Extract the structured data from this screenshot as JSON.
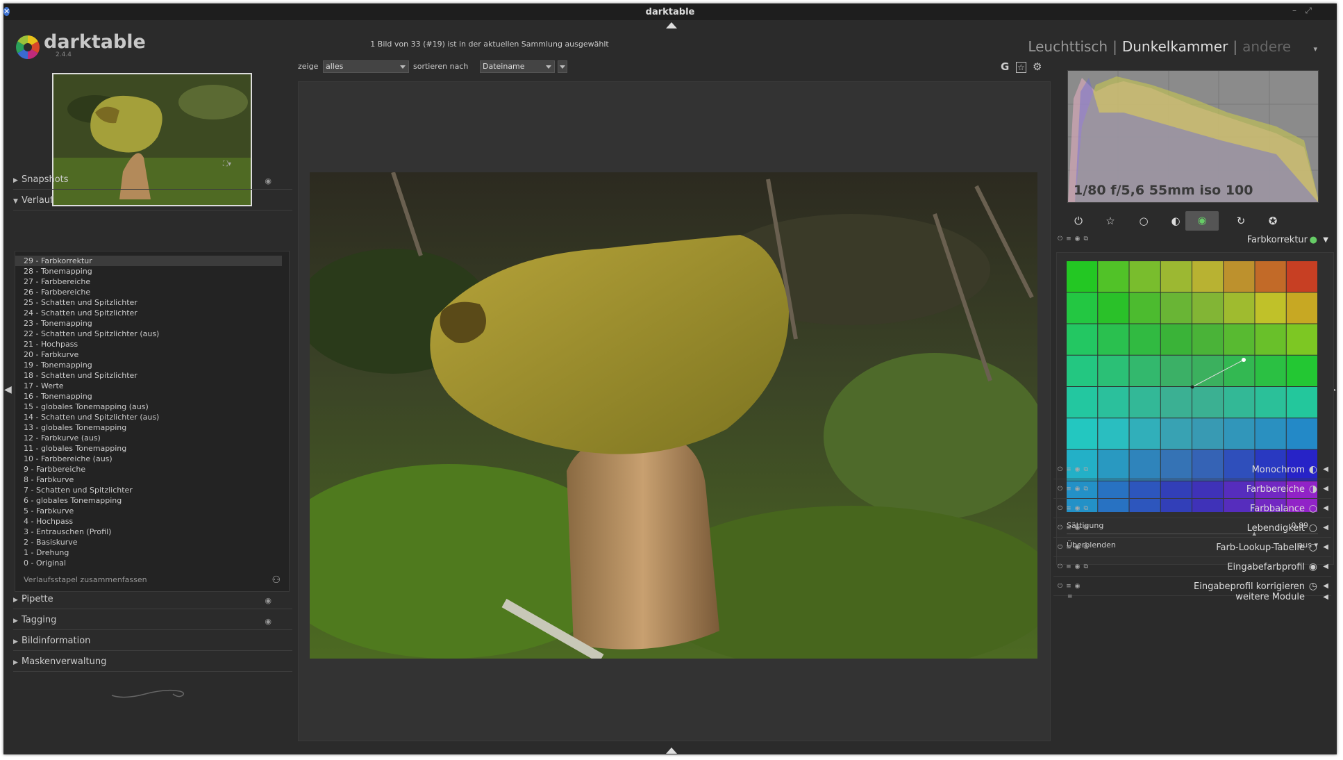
{
  "window": {
    "title": "darktable"
  },
  "app": {
    "name": "darktable",
    "version": "2.4.4"
  },
  "selection_info": "1 Bild von 33 (#19) ist in der aktuellen Sammlung ausgewählt",
  "views": {
    "lighttable": "Leuchttisch",
    "darkroom": "Dunkelkammer",
    "other": "andere",
    "separator": "|"
  },
  "toolbar": {
    "show_label": "zeige",
    "show_value": "alles",
    "sort_label": "sortieren nach",
    "sort_value": "Dateiname",
    "g_label": "G"
  },
  "left": {
    "snapshots": "Snapshots",
    "history_title": "Verlauf",
    "history": [
      "29 - Farbkorrektur",
      "28 - Tonemapping",
      "27 - Farbbereiche",
      "26 - Farbbereiche",
      "25 - Schatten und Spitzlichter",
      "24 - Schatten und Spitzlichter",
      "23 - Tonemapping",
      "22 - Schatten und Spitzlichter (aus)",
      "21 - Hochpass",
      "20 - Farbkurve",
      "19 - Tonemapping",
      "18 - Schatten und Spitzlichter",
      "17 - Werte",
      "16 - Tonemapping",
      "15 - globales Tonemapping (aus)",
      "14 - Schatten und Spitzlichter (aus)",
      "13 - globales Tonemapping",
      "12 - Farbkurve (aus)",
      "11 - globales Tonemapping",
      "10 - Farbbereiche (aus)",
      "9 - Farbbereiche",
      "8 - Farbkurve",
      "7 - Schatten und Spitzlichter",
      "6 - globales Tonemapping",
      "5 - Farbkurve",
      "4 - Hochpass",
      "3 - Entrauschen (Profil)",
      "2 - Basiskurve",
      "1 - Drehung",
      "0 - Original"
    ],
    "compress": "Verlaufsstapel zusammenfassen",
    "pipette": "Pipette",
    "tagging": "Tagging",
    "image_info": "Bildinformation",
    "mask_manager": "Maskenverwaltung"
  },
  "right": {
    "exif": "1/80 f/5,6 55mm iso 100",
    "farbkorrektur": {
      "title": "Farbkorrektur",
      "saturation_label": "Sättigung",
      "saturation_value": "0,89",
      "saturation_fraction": 0.75,
      "blend_label": "Überblenden",
      "blend_value": "aus"
    },
    "modules": [
      "Monochrom",
      "Farbbereiche",
      "Farbbalance",
      "Lebendigkeit",
      "Farb-Lookup-Tabelle",
      "Eingabefarbprofil",
      "Eingabeprofil korrigieren"
    ],
    "more_modules": "weitere Module"
  }
}
